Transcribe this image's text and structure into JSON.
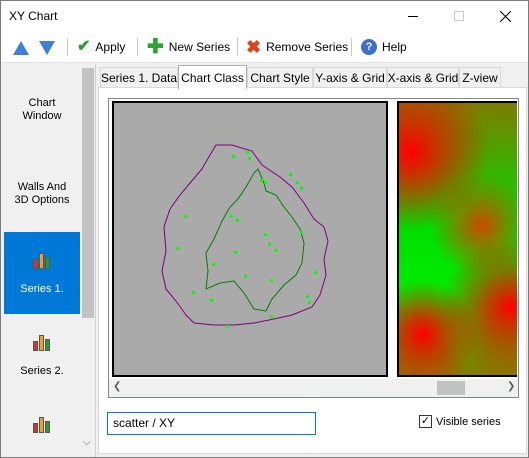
{
  "window": {
    "title": "XY Chart"
  },
  "toolbar": {
    "apply_label": "Apply",
    "new_series_label": "New Series",
    "remove_series_label": "Remove Series",
    "help_label": "Help"
  },
  "sidebar": {
    "items": [
      {
        "label": "Chart Window"
      },
      {
        "label": "Walls And 3D Options"
      },
      {
        "label": "Series 1."
      },
      {
        "label": "Series 2."
      }
    ]
  },
  "tabs": [
    {
      "label": "Series 1. Data"
    },
    {
      "label": "Chart Class"
    },
    {
      "label": "Chart Style"
    },
    {
      "label": "Y-axis & Grid"
    },
    {
      "label": "X-axis & Grid"
    },
    {
      "label": "Z-view"
    }
  ],
  "chart_class": {
    "type_value": "scatter / XY",
    "visible_series_label": "Visible series",
    "visible_series_checked": true
  },
  "colors": {
    "accent": "#0078d7",
    "preview_bg": "#aaaaaa",
    "contour_outer": "#800080",
    "contour_inner": "#008000",
    "points": "#00ff00"
  }
}
